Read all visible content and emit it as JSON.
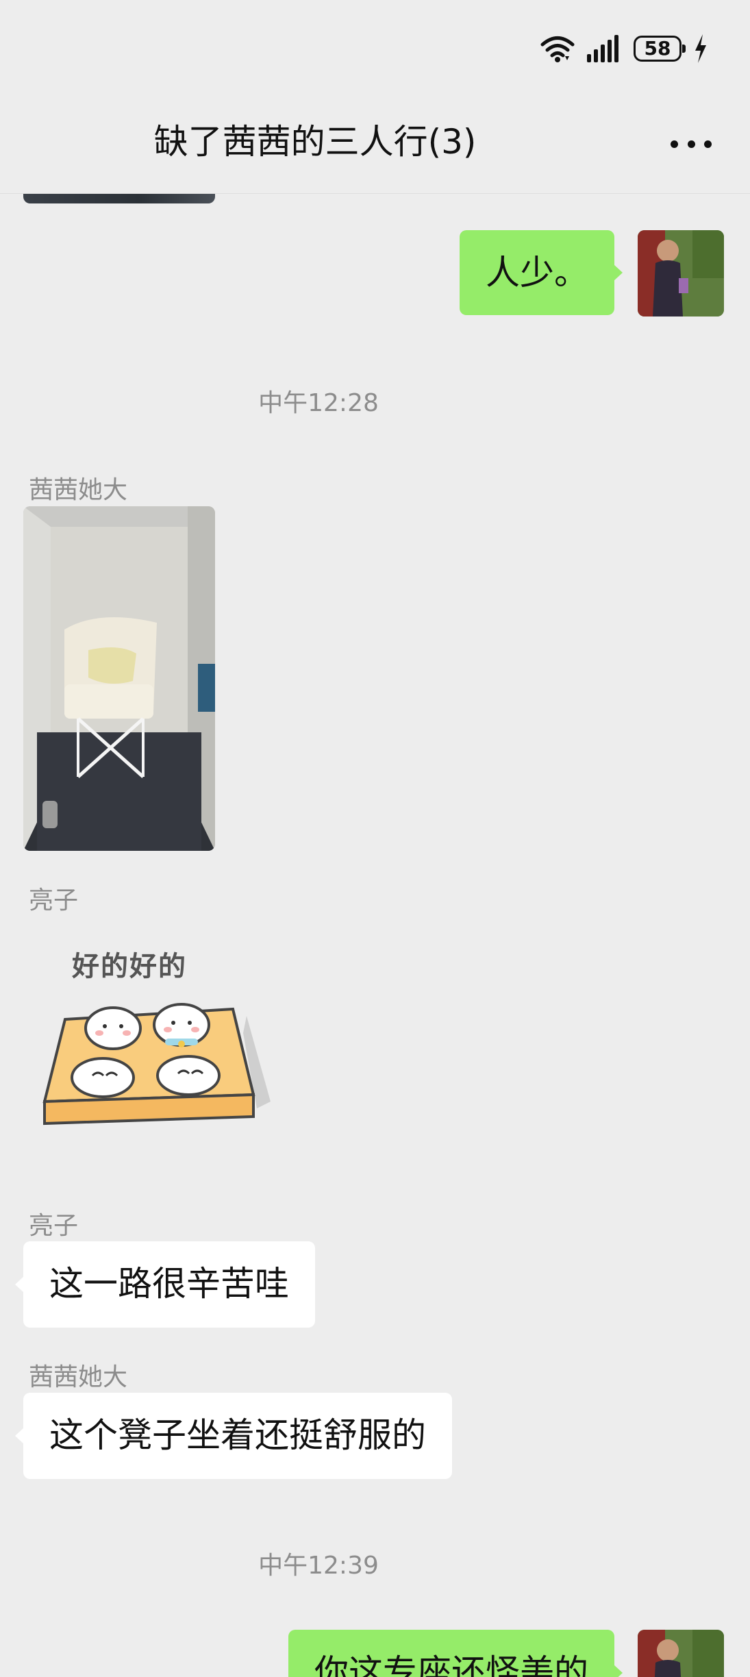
{
  "status_bar": {
    "battery_level": "58",
    "icons": [
      "wifi-icon",
      "signal-icon",
      "battery-icon",
      "charging-icon"
    ]
  },
  "header": {
    "title": "缺了茜茜的三人行(3)",
    "more_icon": "more-dots-icon"
  },
  "messages": [
    {
      "type": "text",
      "direction": "out",
      "text": "人少。"
    },
    {
      "type": "time",
      "text": "中午12:28"
    },
    {
      "type": "image",
      "direction": "in",
      "sender": "茜茜她大"
    },
    {
      "type": "sticker",
      "direction": "in",
      "sender": "亮子",
      "text": "好的好的"
    },
    {
      "type": "text",
      "direction": "in",
      "sender": "亮子",
      "text": "这一路很辛苦哇"
    },
    {
      "type": "text",
      "direction": "in",
      "sender": "茜茜她大",
      "text": "这个凳子坐着还挺舒服的"
    },
    {
      "type": "time",
      "text": "中午12:39"
    },
    {
      "type": "text",
      "direction": "out",
      "text": "你这专座还怪美的"
    }
  ],
  "colors": {
    "background": "#ededed",
    "outgoing_bubble": "#95ec69",
    "incoming_bubble": "#ffffff",
    "meta_text": "#8c8c8c"
  }
}
